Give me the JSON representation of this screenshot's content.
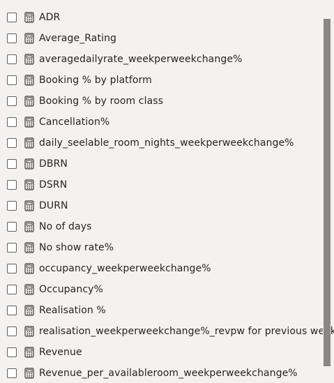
{
  "fields": [
    {
      "label": "ADR",
      "checked": false,
      "icon": "calculator-icon"
    },
    {
      "label": "Average_Rating",
      "checked": false,
      "icon": "calculator-icon"
    },
    {
      "label": "averagedailyrate_weekperweekchange%",
      "checked": false,
      "icon": "calculator-icon"
    },
    {
      "label": "Booking % by platform",
      "checked": false,
      "icon": "calculator-icon"
    },
    {
      "label": "Booking % by room class",
      "checked": false,
      "icon": "calculator-icon"
    },
    {
      "label": "Cancellation%",
      "checked": false,
      "icon": "calculator-icon"
    },
    {
      "label": "daily_seelable_room_nights_weekperweekchange%",
      "checked": false,
      "icon": "calculator-icon"
    },
    {
      "label": "DBRN",
      "checked": false,
      "icon": "calculator-icon"
    },
    {
      "label": "DSRN",
      "checked": false,
      "icon": "calculator-icon"
    },
    {
      "label": "DURN",
      "checked": false,
      "icon": "calculator-icon"
    },
    {
      "label": "No of days",
      "checked": false,
      "icon": "calculator-icon"
    },
    {
      "label": "No show rate%",
      "checked": false,
      "icon": "calculator-icon"
    },
    {
      "label": "occupancy_weekperweekchange%",
      "checked": false,
      "icon": "calculator-icon"
    },
    {
      "label": "Occupancy%",
      "checked": false,
      "icon": "calculator-icon"
    },
    {
      "label": "Realisation %",
      "checked": false,
      "icon": "calculator-icon"
    },
    {
      "label": "realisation_weekperweekchange%_revpw for previous week",
      "checked": false,
      "icon": "calculator-icon"
    },
    {
      "label": "Revenue",
      "checked": false,
      "icon": "calculator-icon"
    },
    {
      "label": "Revenue_per_availableroom_weekperweekchange%",
      "checked": false,
      "icon": "calculator-icon"
    }
  ],
  "colors": {
    "background": "#f3f2f1",
    "text": "#252423",
    "checkbox_border": "#5f5f5f",
    "icon": "#3b3a39",
    "scrollbar_thumb": "#8a8886"
  }
}
